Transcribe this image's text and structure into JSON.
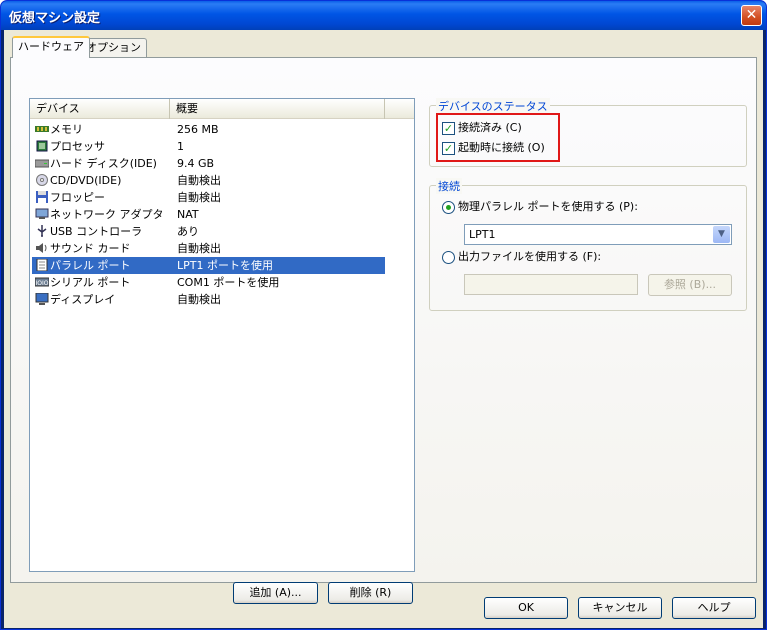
{
  "window": {
    "title": "仮想マシン設定",
    "close_glyph": "✕"
  },
  "tabs": [
    {
      "label": "ハードウェア"
    },
    {
      "label": "オプション"
    }
  ],
  "device_list": {
    "columns": [
      "デバイス",
      "概要"
    ],
    "rows": [
      {
        "icon": "memory-icon",
        "name": "メモリ",
        "summary": "256 MB"
      },
      {
        "icon": "processor-icon",
        "name": "プロセッサ",
        "summary": "1"
      },
      {
        "icon": "hard-disk-icon",
        "name": "ハード ディスク(IDE)",
        "summary": "9.4 GB"
      },
      {
        "icon": "cd-dvd-icon",
        "name": "CD/DVD(IDE)",
        "summary": "自動検出"
      },
      {
        "icon": "floppy-icon",
        "name": "フロッピー",
        "summary": "自動検出"
      },
      {
        "icon": "network-adapter-icon",
        "name": "ネットワーク アダプタ",
        "summary": "NAT"
      },
      {
        "icon": "usb-icon",
        "name": "USB コントローラ",
        "summary": "あり"
      },
      {
        "icon": "sound-card-icon",
        "name": "サウンド カード",
        "summary": "自動検出"
      },
      {
        "icon": "parallel-port-icon",
        "name": "パラレル ポート",
        "summary": "LPT1 ポートを使用",
        "selected": true
      },
      {
        "icon": "serial-port-icon",
        "name": "シリアル ポート",
        "summary": "COM1 ポートを使用"
      },
      {
        "icon": "display-icon",
        "name": "ディスプレイ",
        "summary": "自動検出"
      }
    ]
  },
  "list_buttons": {
    "add": "追加 (A)...",
    "remove": "削除 (R)"
  },
  "device_status": {
    "title": "デバイスのステータス",
    "connected": {
      "label": "接続済み (C)",
      "checked": true
    },
    "connect_at_power_on": {
      "label": "起動時に接続 (O)",
      "checked": true
    }
  },
  "connection": {
    "title": "接続",
    "use_physical": {
      "label": "物理パラレル ポートを使用する (P):",
      "selected": true
    },
    "physical_port_value": "LPT1",
    "use_output_file": {
      "label": "出力ファイルを使用する (F):",
      "selected": false
    },
    "output_file_value": "",
    "browse": "参照 (B)..."
  },
  "footer": {
    "ok": "OK",
    "cancel": "キャンセル",
    "help": "ヘルプ"
  },
  "colors": {
    "selection": "#316ac5",
    "highlight_box": "#e01818",
    "group_title": "#0046d5"
  }
}
